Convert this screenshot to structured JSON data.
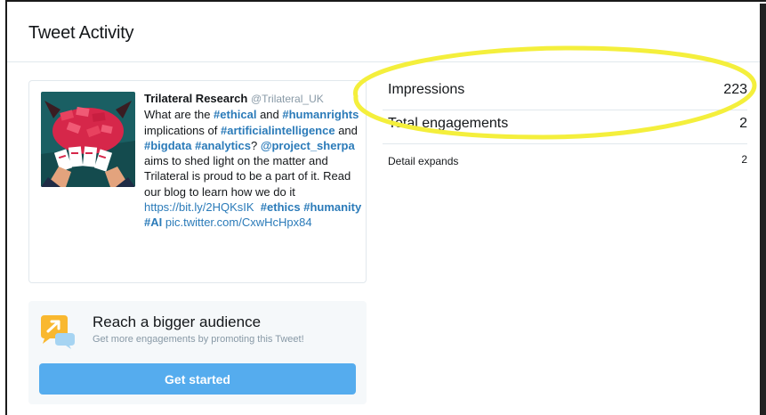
{
  "header": {
    "title": "Tweet Activity"
  },
  "tweet": {
    "author_name": "Trilateral Research",
    "author_handle": "@Trilateral_UK",
    "text": {
      "t1": "What are the ",
      "tag_ethical": "#ethical",
      "t2": " and ",
      "tag_humanrights": "#humanrights",
      "t3": " implications of ",
      "tag_ai": "#artificialintelligence",
      "t4": " and ",
      "tag_bigdata": "#bigdata",
      "tag_analytics": "#analytics",
      "t5": "? ",
      "mention_sherpa": "@project_sherpa",
      "t6": " aims to shed light on the matter and Trilateral is proud to be a part of it. Read our blog to learn how we do it ",
      "link_blog": "https://bit.ly/2HQKsIK",
      "tag_ethics": "#ethics",
      "tag_humanity": "#humanity",
      "tag_AI": "#AI",
      "link_pic": "pic.twitter.com/CxwHcHpx84"
    },
    "media_icon": "tweet-image-cards-held-by-hands"
  },
  "promo": {
    "icon": "promote-megaphone-icon",
    "title": "Reach a bigger audience",
    "subtitle": "Get more engagements by promoting this Tweet!",
    "button_label": "Get started"
  },
  "metrics": [
    {
      "label": "Impressions",
      "value": "223"
    },
    {
      "label": "Total engagements",
      "value": "2"
    },
    {
      "label": "Detail expands",
      "value": "2"
    }
  ],
  "colors": {
    "link": "#2b7bb9",
    "button": "#55acee",
    "highlight": "#f4ef3c"
  }
}
